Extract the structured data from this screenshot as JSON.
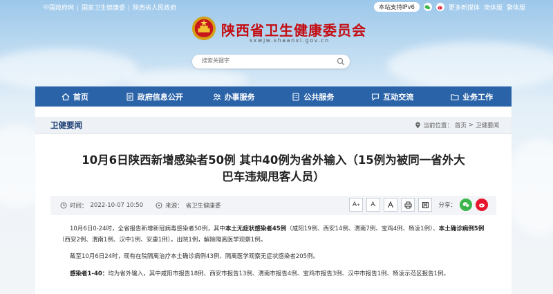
{
  "top_links": [
    "中国政府网",
    "国家卫生健康委",
    "陕西省人民政府"
  ],
  "top_right": {
    "ipv6": "本站支持IPv6",
    "more": "更多新媒体",
    "simplified": "简体版",
    "traditional": "繁体版"
  },
  "site": {
    "title": "陕西省卫生健康委员会",
    "url": "sxwjw.shaanxi.gov.cn"
  },
  "search": {
    "placeholder": "搜索关键字"
  },
  "nav": [
    {
      "label": "首页",
      "icon": "home-icon"
    },
    {
      "label": "政府信息公开",
      "icon": "document-icon"
    },
    {
      "label": "办事服务",
      "icon": "people-icon"
    },
    {
      "label": "公共服务",
      "icon": "doc-list-icon"
    },
    {
      "label": "互动交流",
      "icon": "chat-icon"
    },
    {
      "label": "业务工作",
      "icon": "folder-icon"
    }
  ],
  "section": {
    "title": "卫健要闻",
    "crumb_prefix": "当前位置：",
    "crumb_home": "首页",
    "crumb_sep": ">",
    "crumb_current": "卫健要闻"
  },
  "article": {
    "title_line1": "10月6日陕西新增感染者50例 其中40例为省外输入（15例为被同一省外大",
    "title_line2": "巴车违规甩客人员）",
    "time_label": "时间：",
    "time": "2022-10-07 10:50",
    "source_label": "来源：",
    "source": "省卫生健康委",
    "share_label": "分享：",
    "p1_a": "10月6日0-24时，全省报告新增新冠病毒感染者50例，其中",
    "p1_b": "本土无症状感染者45例",
    "p1_c": "（咸阳19例、西安14例、渭南7例、宝鸡4例、杨凌1例）、",
    "p1_d": "本土确诊病例5例",
    "p1_e": "（西安2例、渭南1例、汉中1例、安康1例）。出院1例，解除隔离医学观察1例。",
    "p2": "截至10月6日24时，现有在院隔离治疗本土确诊病例43例、隔离医学观察无症状感染者205例。",
    "p3_a": "感染者1-40：",
    "p3_b": "均为省外输入，其中咸阳市报告18例、西安市报告13例、渭南市报告4例、宝鸡市报告3例、汉中市报告1例、杨凌示范区报告1例。"
  },
  "tools": {
    "font_up": "A",
    "font_down": "A",
    "print": "print-icon",
    "save": "save-icon"
  },
  "colors": {
    "nav": "#2a63a8",
    "brand_red": "#c40d12"
  }
}
